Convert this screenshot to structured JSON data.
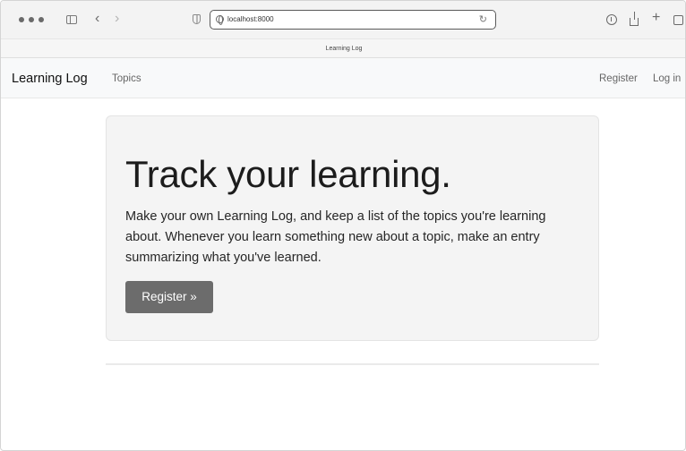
{
  "browser": {
    "url": "localhost:8000",
    "tab_title": "Learning Log",
    "icons": {
      "back": "‹",
      "forward": "›",
      "reload": "↻",
      "new_tab": "+"
    }
  },
  "navbar": {
    "brand": "Learning Log",
    "links": [
      {
        "label": "Topics"
      }
    ],
    "right_links": [
      {
        "label": "Register"
      },
      {
        "label": "Log in"
      }
    ]
  },
  "hero": {
    "title": "Track your learning.",
    "body": "Make your own Learning Log, and keep a list of the topics you're learning about. Whenever you learn something new about a topic, make an entry summarizing what you've learned.",
    "button_label": "Register »",
    "button_color": "#6c6c6c"
  }
}
